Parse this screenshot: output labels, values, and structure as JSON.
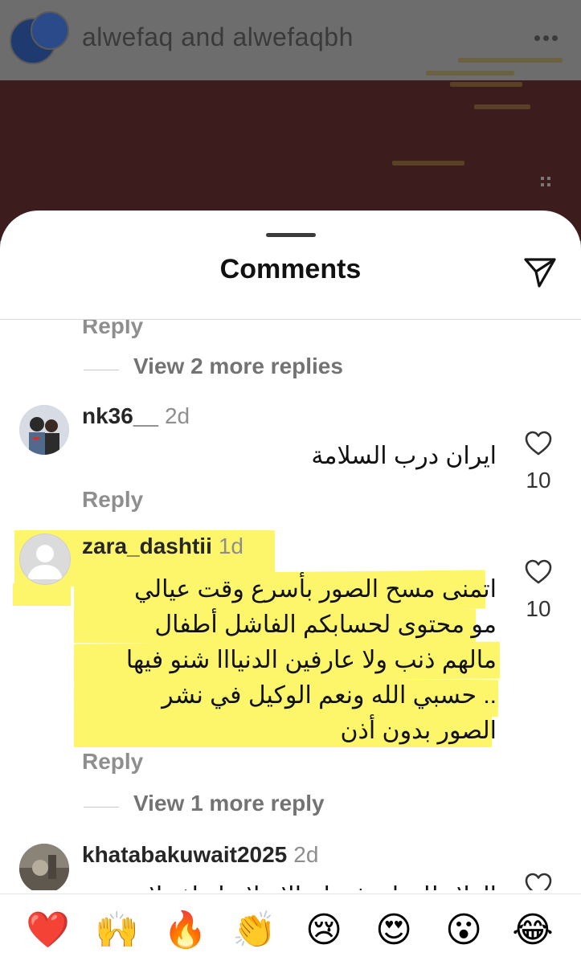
{
  "post": {
    "title": "alwefaq and alwefaqbh"
  },
  "sheet": {
    "title": "Comments"
  },
  "thread": {
    "top_reply_label": "Reply",
    "view_more_1": "View 2 more replies",
    "view_more_2": "View 1 more reply"
  },
  "comments": [
    {
      "username": "nk36__",
      "time": "2d",
      "lines": [
        "ايران درب السلامة"
      ],
      "reply_label": "Reply",
      "likes": "10"
    },
    {
      "username": "zara_dashtii",
      "time": "1d",
      "lines": [
        "اتمنى مسح الصور بأسرع وقت عيالي",
        "مو محتوى لحسابكم الفاشل أطفال",
        "مالهم ذنب ولا عارفين الدنيااا شنو فيها",
        ".. حسبي الله ونعم الوكيل في نشر",
        "الصور بدون أذن"
      ],
      "reply_label": "Reply",
      "likes": "10",
      "highlighted": true
    },
    {
      "username": "khatabakuwait2025",
      "time": "2d",
      "lines": [
        "الولاء للوطن فقط والاسلام انقاذ ولا"
      ]
    }
  ],
  "reactions": [
    {
      "icon": "heart-emoji",
      "glyph": "❤️"
    },
    {
      "icon": "raised-hands-emoji",
      "glyph": "🙌"
    },
    {
      "icon": "fire-emoji",
      "glyph": "🔥"
    },
    {
      "icon": "clapping-hands-emoji",
      "glyph": "👏"
    },
    {
      "icon": "crying-face-emoji",
      "glyph": "😢"
    },
    {
      "icon": "heart-eyes-emoji",
      "glyph": "😍"
    },
    {
      "icon": "surprised-face-emoji",
      "glyph": "😮"
    },
    {
      "icon": "tears-of-joy-emoji",
      "glyph": "😂"
    }
  ],
  "colors": {
    "highlight": "#fdf66b",
    "overlay": "#6d6d6d",
    "post_bg": "#3c1c1c"
  }
}
